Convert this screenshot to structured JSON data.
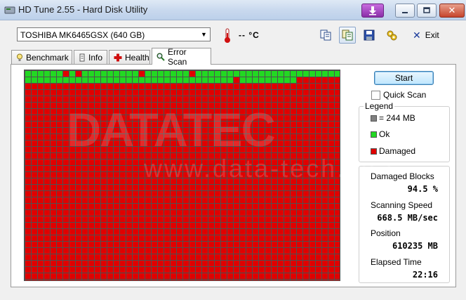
{
  "window": {
    "title": "HD Tune 2.55 - Hard Disk Utility"
  },
  "toolbar": {
    "drive": "TOSHIBA MK6465GSX (640 GB)",
    "temperature": "-- °C",
    "exit_label": "Exit",
    "icons": [
      "copy-icon",
      "copy-all-icon",
      "save-icon",
      "options-icon"
    ]
  },
  "tabs": [
    {
      "label": "Benchmark",
      "icon": "lightbulb-icon"
    },
    {
      "label": "Info",
      "icon": "info-icon"
    },
    {
      "label": "Health",
      "icon": "health-cross-icon"
    },
    {
      "label": "Error Scan",
      "icon": "magnifier-icon",
      "active": true
    }
  ],
  "scan": {
    "start_label": "Start",
    "quick_scan_label": "Quick Scan",
    "quick_scan_checked": false
  },
  "legend": {
    "title": "Legend",
    "block_size": "= 244 MB",
    "ok": "Ok",
    "damaged": "Damaged"
  },
  "stats": {
    "damaged_blocks_label": "Damaged Blocks",
    "damaged_blocks_value": "94.5 %",
    "scanning_speed_label": "Scanning Speed",
    "scanning_speed_value": "668.5 MB/sec",
    "position_label": "Position",
    "position_value": "610235 MB",
    "elapsed_label": "Elapsed Time",
    "elapsed_value": "22:16"
  },
  "watermark": {
    "logo": "DATATEC",
    "url": "www.data-tech.co.j"
  },
  "colors": {
    "ok": "#22d822",
    "damaged": "#e00000",
    "grid_line": "#505050"
  }
}
